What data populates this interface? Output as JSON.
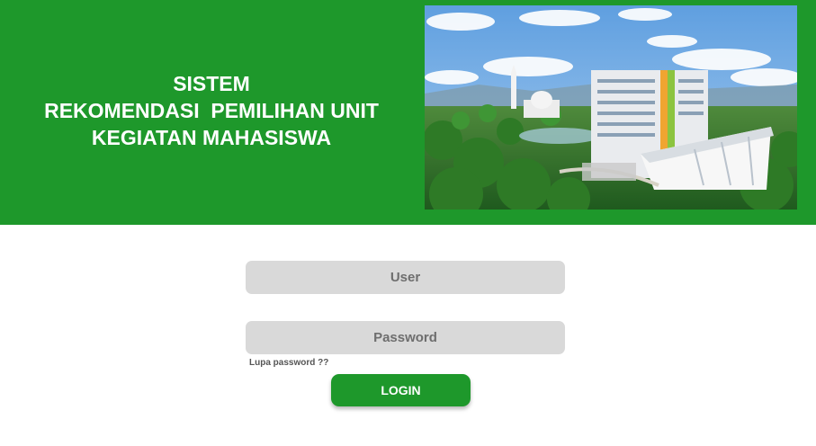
{
  "header": {
    "title_lines": [
      "SISTEM",
      "REKOMENDASI  PEMILIHAN UNIT",
      "KEGIATAN MAHASISWA"
    ],
    "background_color": "#1e982b",
    "photo": "campus-building-photo"
  },
  "login_form": {
    "user_placeholder": "User",
    "user_value": "",
    "password_placeholder": "Password",
    "password_value": "",
    "forgot_label": "Lupa password ??",
    "login_label": "LOGIN"
  }
}
